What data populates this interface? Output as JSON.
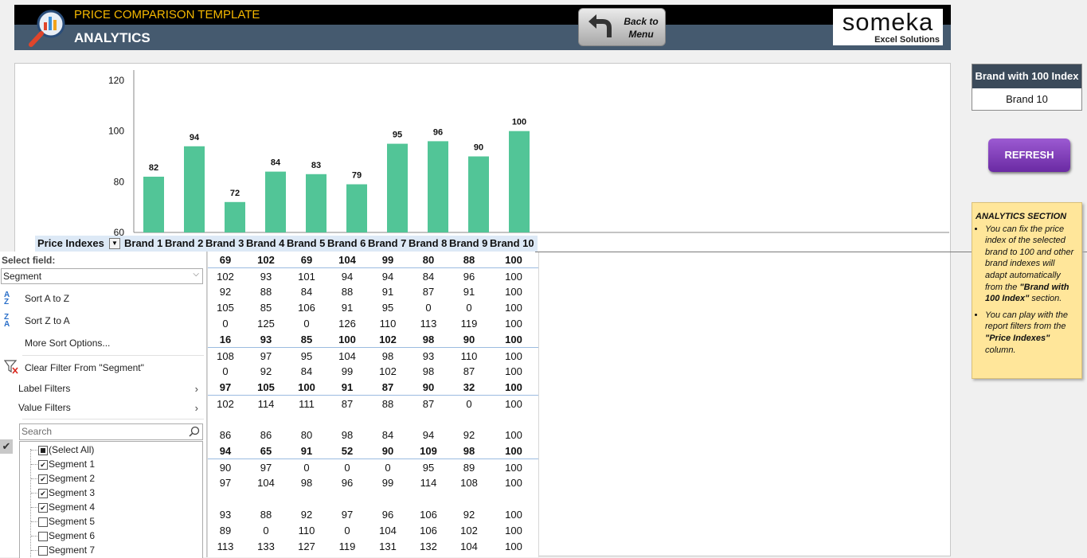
{
  "header": {
    "subtitle": "PRICE COMPARISON TEMPLATE",
    "title": "ANALYTICS",
    "back_button": "Back to\nMenu"
  },
  "brand_logo": {
    "name": "someka",
    "tagline": "Excel Solutions"
  },
  "chart_data": {
    "type": "bar",
    "categories": [
      "Brand 1",
      "Brand 2",
      "Brand 3",
      "Brand 4",
      "Brand 5",
      "Brand 6",
      "Brand 7",
      "Brand 8",
      "Brand 9",
      "Brand 10"
    ],
    "values": [
      82,
      94,
      72,
      84,
      83,
      79,
      95,
      96,
      90,
      100
    ],
    "yticks": [
      60,
      80,
      100,
      120
    ],
    "ylim": [
      60,
      120
    ],
    "grid": false,
    "bar_color": "#52c597"
  },
  "pivot": {
    "row_field": "Price Indexes",
    "columns": [
      "Brand 1",
      "Brand 2",
      "Brand 3",
      "Brand 4",
      "Brand 5",
      "Brand 6",
      "Brand 7",
      "Brand 8",
      "Brand 9",
      "Brand 10"
    ],
    "rows": [
      {
        "bold": true,
        "sep": false,
        "values": [
          "69",
          "102",
          "69",
          "104",
          "99",
          "80",
          "88",
          "100"
        ]
      },
      {
        "bold": false,
        "sep": true,
        "values": [
          "102",
          "93",
          "101",
          "94",
          "94",
          "84",
          "96",
          "100"
        ]
      },
      {
        "bold": false,
        "sep": false,
        "values": [
          "92",
          "88",
          "84",
          "88",
          "91",
          "87",
          "91",
          "100"
        ]
      },
      {
        "bold": false,
        "sep": false,
        "values": [
          "105",
          "85",
          "106",
          "91",
          "95",
          "0",
          "0",
          "100"
        ]
      },
      {
        "bold": false,
        "sep": false,
        "values": [
          "0",
          "125",
          "0",
          "126",
          "110",
          "113",
          "119",
          "100"
        ]
      },
      {
        "bold": true,
        "sep": false,
        "values": [
          "16",
          "93",
          "85",
          "100",
          "102",
          "98",
          "90",
          "100"
        ]
      },
      {
        "bold": false,
        "sep": true,
        "values": [
          "108",
          "97",
          "95",
          "104",
          "98",
          "93",
          "110",
          "100"
        ]
      },
      {
        "bold": false,
        "sep": false,
        "values": [
          "0",
          "92",
          "84",
          "99",
          "102",
          "98",
          "87",
          "100"
        ]
      },
      {
        "bold": true,
        "sep": false,
        "values": [
          "97",
          "105",
          "100",
          "91",
          "87",
          "90",
          "32",
          "100"
        ]
      },
      {
        "bold": false,
        "sep": true,
        "values": [
          "102",
          "114",
          "111",
          "87",
          "88",
          "87",
          "0",
          "100"
        ]
      },
      {
        "bold": false,
        "sep": false,
        "values": [
          "",
          "",
          "",
          "",
          "",
          "",
          "",
          ""
        ]
      },
      {
        "bold": false,
        "sep": false,
        "values": [
          "86",
          "86",
          "80",
          "98",
          "84",
          "94",
          "92",
          "100"
        ]
      },
      {
        "bold": true,
        "sep": false,
        "values": [
          "94",
          "65",
          "91",
          "52",
          "90",
          "109",
          "98",
          "100"
        ]
      },
      {
        "bold": false,
        "sep": true,
        "values": [
          "90",
          "97",
          "0",
          "0",
          "0",
          "95",
          "89",
          "100"
        ]
      },
      {
        "bold": false,
        "sep": false,
        "values": [
          "97",
          "104",
          "98",
          "96",
          "99",
          "114",
          "108",
          "100"
        ]
      },
      {
        "bold": false,
        "sep": false,
        "values": [
          "",
          "",
          "",
          "",
          "",
          "",
          "",
          ""
        ]
      },
      {
        "bold": false,
        "sep": false,
        "values": [
          "93",
          "88",
          "92",
          "97",
          "96",
          "106",
          "92",
          "100"
        ]
      },
      {
        "bold": false,
        "sep": false,
        "values": [
          "89",
          "0",
          "110",
          "0",
          "104",
          "106",
          "102",
          "100"
        ]
      },
      {
        "bold": false,
        "sep": false,
        "values": [
          "113",
          "133",
          "127",
          "119",
          "131",
          "132",
          "104",
          "100"
        ]
      }
    ]
  },
  "filter_menu": {
    "select_label": "Select field:",
    "selected_field": "Segment",
    "sort_az": "Sort A to Z",
    "sort_za": "Sort Z to A",
    "more_sort": "More Sort Options...",
    "clear_filter": "Clear Filter From \"Segment\"",
    "label_filters": "Label Filters",
    "value_filters": "Value Filters",
    "search_placeholder": "Search",
    "items": [
      {
        "label": "(Select All)",
        "state": "partial"
      },
      {
        "label": "Segment 1",
        "state": "checked"
      },
      {
        "label": "Segment 2",
        "state": "checked"
      },
      {
        "label": "Segment 3",
        "state": "checked"
      },
      {
        "label": "Segment 4",
        "state": "checked"
      },
      {
        "label": "Segment 5",
        "state": "unchecked"
      },
      {
        "label": "Segment 6",
        "state": "unchecked"
      },
      {
        "label": "Segment 7",
        "state": "unchecked"
      }
    ]
  },
  "index_box": {
    "header": "Brand with 100 Index",
    "value": "Brand 10"
  },
  "refresh_button": "REFRESH",
  "note": {
    "title": "ANALYTICS SECTION",
    "bullet1_pre": "You can fix the price index of the selected brand to 100 and other brand indexes will adapt automatically from the ",
    "bullet1_bold": "\"Brand with 100 Index\"",
    "bullet1_post": " section.",
    "bullet2_pre": "You can play with the report filters from the ",
    "bullet2_bold": "\"Price Indexes\"",
    "bullet2_post": " column."
  }
}
